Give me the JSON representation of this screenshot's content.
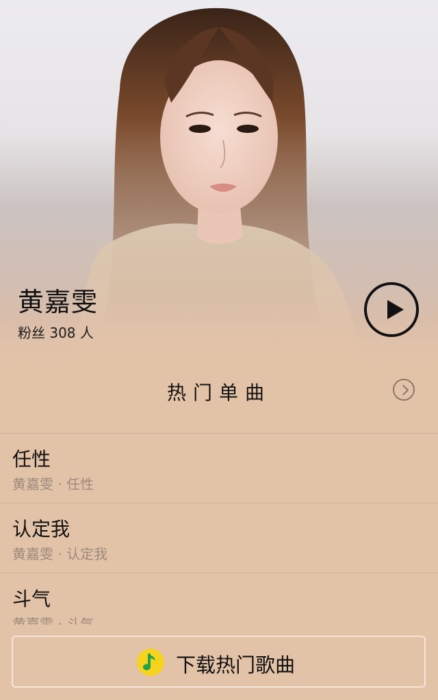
{
  "artist": {
    "name": "黄嘉雯",
    "fans_label": "粉丝 308 人"
  },
  "section": {
    "title": "热门单曲"
  },
  "songs": [
    {
      "title": "任性",
      "subtitle": "黄嘉雯 · 任性"
    },
    {
      "title": "认定我",
      "subtitle": "黄嘉雯 · 认定我"
    },
    {
      "title": "斗气",
      "subtitle": "黄嘉雯 · 斗气"
    }
  ],
  "download": {
    "label": "下载热门歌曲"
  },
  "icons": {
    "play": "play-icon",
    "more": "chevron-right-icon",
    "app": "qq-music-icon"
  },
  "colors": {
    "background": "#e3c3a8",
    "text": "#111111",
    "subtext": "#9c8a7c",
    "accent_icon": "#f6d31c"
  }
}
